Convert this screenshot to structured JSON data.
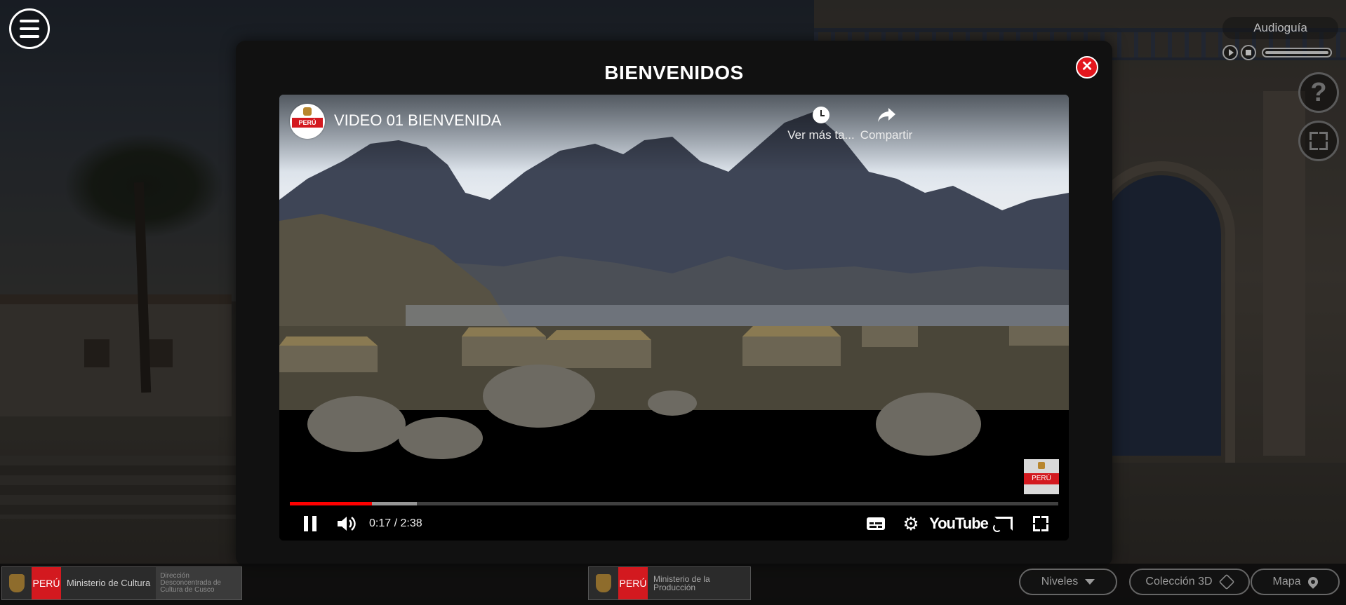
{
  "modal": {
    "title": "BIENVENIDOS",
    "close_label": "✕"
  },
  "audioguide": {
    "title": "Audioguía"
  },
  "side_buttons": {
    "help_label": "?"
  },
  "video": {
    "title": "VIDEO 01 BIENVENIDA",
    "channel_logo_text": "PERÚ",
    "watch_later_label": "Ver más ta...",
    "share_label": "Compartir",
    "watermark_text": "PERÚ",
    "current_time": "0:17 / 2:38",
    "played_fraction": 0.107,
    "buffered_fraction": 0.165,
    "youtube_label": "YouTube",
    "accent_color": "#ff0000"
  },
  "footer": {
    "logo_left": {
      "peru": "PERÚ",
      "ministry": "Ministerio de Cultura",
      "sub": "Dirección Desconcentrada de Cultura de Cusco"
    },
    "logo_center": {
      "peru": "PERÚ",
      "ministry": "Ministerio de la Producción"
    },
    "levels_label": "Niveles",
    "collection_label": "Colección 3D",
    "map_label": "Mapa"
  },
  "icons": {
    "menu": "hamburger-icon",
    "close": "close-icon",
    "help": "question-icon",
    "fullscreen": "fullscreen-icon",
    "play": "play-icon",
    "stop": "stop-icon",
    "pause": "pause-icon",
    "volume": "volume-icon",
    "subtitles": "subtitles-icon",
    "settings": "gear-icon",
    "cast": "cast-icon",
    "clock": "clock-icon",
    "share": "share-icon",
    "cube": "cube-icon",
    "map": "map-pin-icon"
  }
}
